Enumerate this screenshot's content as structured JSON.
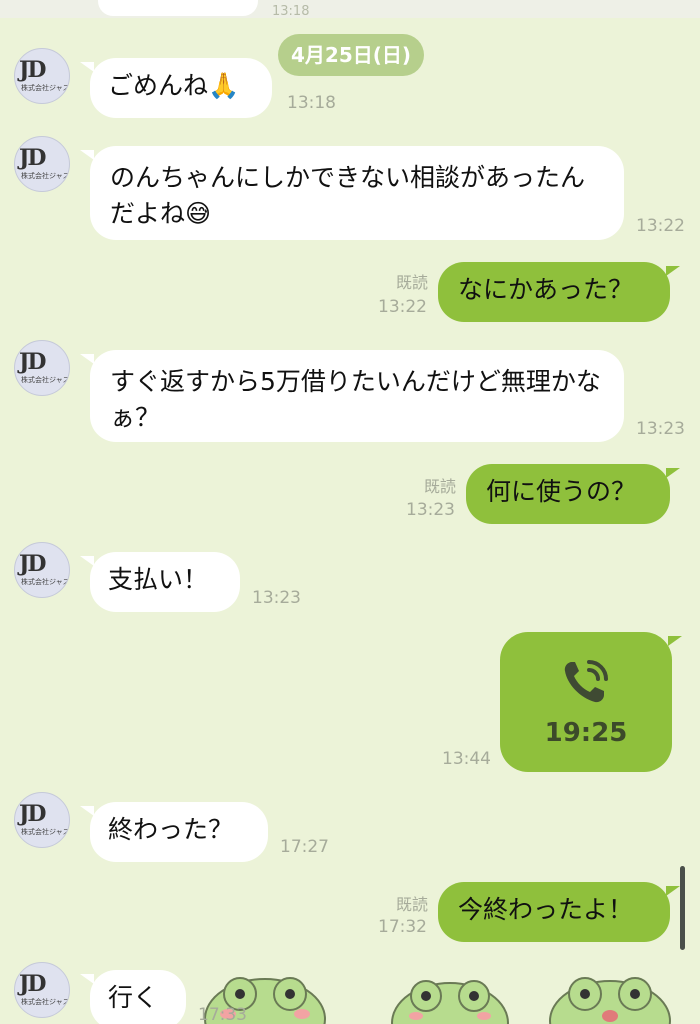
{
  "header": {
    "partial_time": "13:18"
  },
  "date_separator": "4月25日(日)",
  "contact": {
    "logo_text": "JD",
    "logo_subtext": "株式会社ジャストデザイン"
  },
  "messages": [
    {
      "dir": "in",
      "text": "ごめんね🙏",
      "time": "13:18"
    },
    {
      "dir": "in",
      "text": "のんちゃんにしかできない相談があったんだよね😅",
      "time": "13:22"
    },
    {
      "dir": "out",
      "text": "なにかあった？",
      "read": "既読",
      "time": "13:22"
    },
    {
      "dir": "in",
      "text": "すぐ返すから5万借りたいんだけど無理かなぁ？",
      "time": "13:23"
    },
    {
      "dir": "out",
      "text": "何に使うの？",
      "read": "既読",
      "time": "13:23"
    },
    {
      "dir": "in",
      "text": "支払い！",
      "time": "13:23"
    },
    {
      "dir": "out",
      "type": "call",
      "duration": "19:25",
      "time": "13:44",
      "icon": "phone-call-icon"
    },
    {
      "dir": "in",
      "text": "終わった？",
      "time": "17:27"
    },
    {
      "dir": "out",
      "text": "今終わったよ！",
      "read": "既読",
      "time": "17:32"
    },
    {
      "dir": "in",
      "text": "行く",
      "time": "17:33"
    }
  ],
  "colors": {
    "background": "#ecf3d8",
    "outgoing_bubble": "#8fc03c",
    "incoming_bubble": "#ffffff",
    "date_pill": "#b6cf8c",
    "timestamp": "#a6ab9a"
  }
}
